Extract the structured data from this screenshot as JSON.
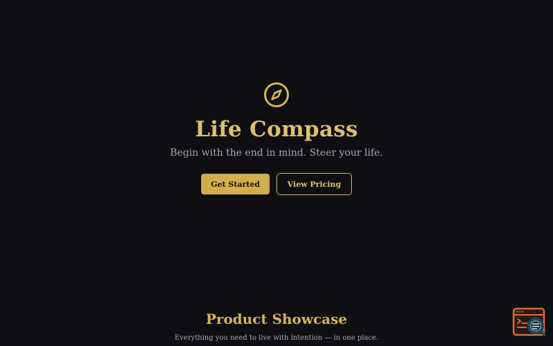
{
  "hero": {
    "icon": "compass-icon",
    "title": "Life Compass",
    "subtitle": "Begin with the end in mind. Steer your life.",
    "primary_button": "Get Started",
    "secondary_button": "View Pricing"
  },
  "showcase": {
    "title": "Product Showcase",
    "subtitle": "Everything you need to live with intention — in one place."
  },
  "widget": {
    "icon": "inspector-icon"
  },
  "colors": {
    "background": "#0f0f13",
    "accent": "#d1ad4b",
    "muted_text": "#a3a8b4",
    "widget": "#e0673b"
  }
}
